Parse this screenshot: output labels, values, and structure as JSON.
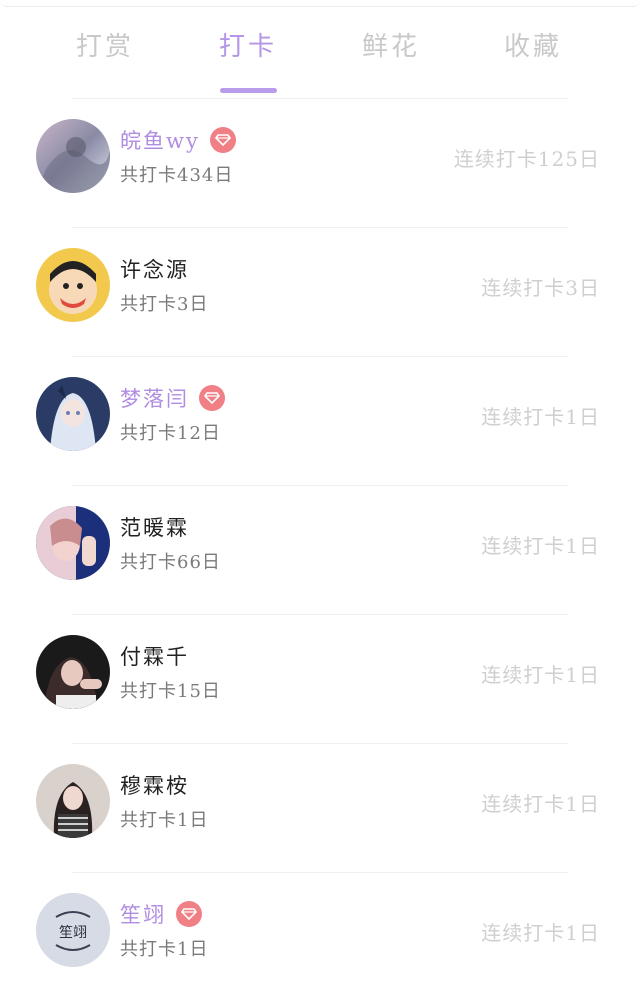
{
  "tabs": [
    {
      "label": "打赏"
    },
    {
      "label": "打卡"
    },
    {
      "label": "鲜花"
    },
    {
      "label": "收藏"
    }
  ],
  "active_tab": "打卡",
  "colors": {
    "accent": "#b496e6",
    "vip_name": "#b08de0",
    "vip_badge": "#f07f86"
  },
  "rows": [
    {
      "name": "皖鱼wy",
      "vip": true,
      "total": "共打卡434日",
      "streak": "连续打卡125日",
      "avatar_icon": "avatar-photo"
    },
    {
      "name": "许念源",
      "vip": false,
      "total": "共打卡3日",
      "streak": "连续打卡3日",
      "avatar_icon": "avatar-cartoon"
    },
    {
      "name": "梦落闫",
      "vip": true,
      "total": "共打卡12日",
      "streak": "连续打卡1日",
      "avatar_icon": "avatar-anime"
    },
    {
      "name": "范暖霖",
      "vip": false,
      "total": "共打卡66日",
      "streak": "连续打卡1日",
      "avatar_icon": "avatar-photo"
    },
    {
      "name": "付霖千",
      "vip": false,
      "total": "共打卡15日",
      "streak": "连续打卡1日",
      "avatar_icon": "avatar-photo"
    },
    {
      "name": "穆霖桉",
      "vip": false,
      "total": "共打卡1日",
      "streak": "连续打卡1日",
      "avatar_icon": "avatar-photo"
    },
    {
      "name": "笙翊",
      "vip": true,
      "total": "共打卡1日",
      "streak": "连续打卡1日",
      "avatar_icon": "avatar-text-logo",
      "avatar_text": "笙翊"
    }
  ]
}
